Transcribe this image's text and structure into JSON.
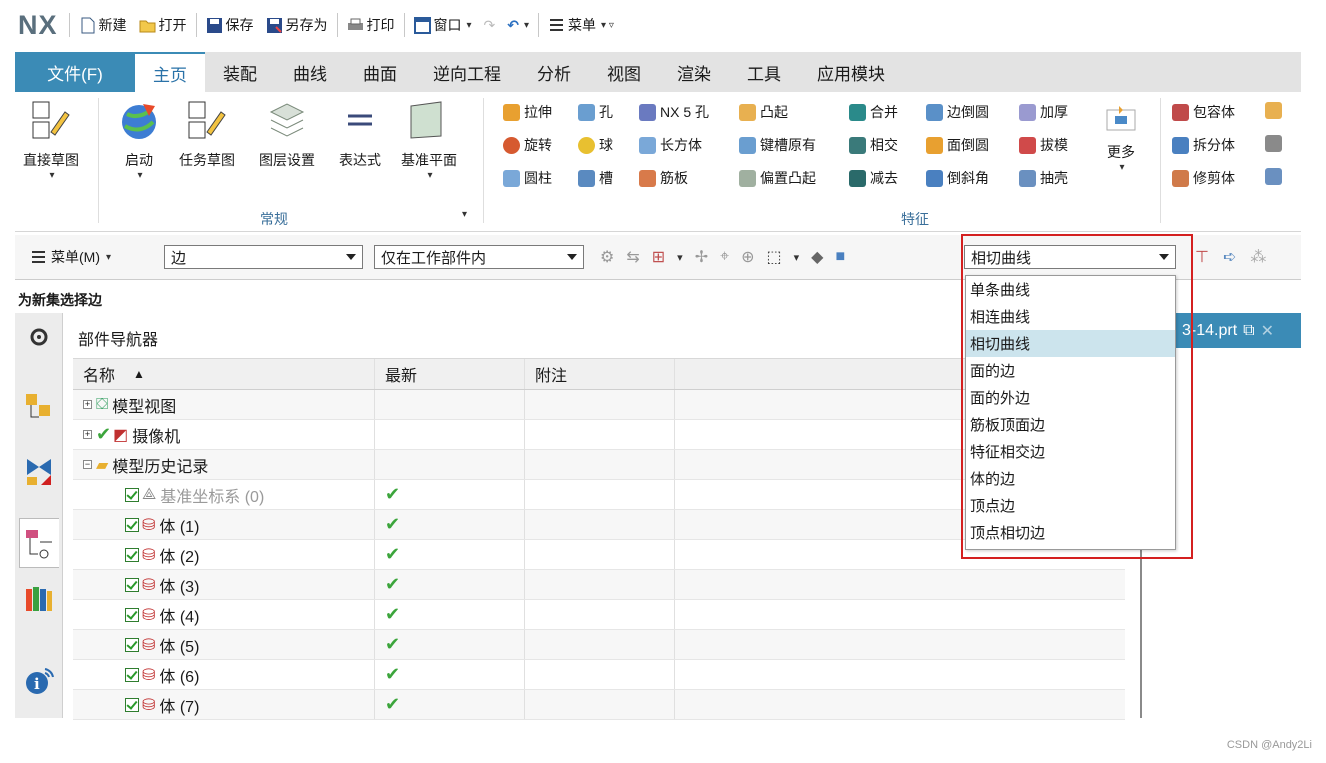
{
  "app": {
    "logo": "NX"
  },
  "qat": [
    {
      "label": "新建",
      "icon": "new-file-icon"
    },
    {
      "label": "打开",
      "icon": "open-folder-icon"
    },
    {
      "label": "保存",
      "icon": "save-icon"
    },
    {
      "label": "另存为",
      "icon": "save-as-icon"
    },
    {
      "label": "打印",
      "icon": "print-icon"
    },
    {
      "label": "窗口",
      "icon": "window-icon"
    },
    {
      "label": "菜单",
      "icon": "menu-icon"
    }
  ],
  "tabs": [
    "文件(F)",
    "主页",
    "装配",
    "曲线",
    "曲面",
    "逆向工程",
    "分析",
    "视图",
    "渲染",
    "工具",
    "应用模块"
  ],
  "ribbon": {
    "big_buttons": [
      "直接草图",
      "启动",
      "任务草图",
      "图层设置",
      "表达式",
      "基准平面",
      "更多"
    ],
    "group_general": "常规",
    "group_feature": "特征",
    "features_col1": [
      "拉伸",
      "旋转",
      "圆柱"
    ],
    "features_col2": [
      "孔",
      "球",
      "槽"
    ],
    "features_col3": [
      "NX 5 孔",
      "长方体",
      "筋板"
    ],
    "features_col4": [
      "凸起",
      "键槽原有",
      "偏置凸起"
    ],
    "features_col5": [
      "合并",
      "相交",
      "减去"
    ],
    "features_col6": [
      "边倒圆",
      "面倒圆",
      "倒斜角"
    ],
    "features_col7": [
      "加厚",
      "拔模",
      "抽壳"
    ],
    "features_col8": [
      "包容体",
      "拆分体",
      "修剪体"
    ]
  },
  "selbar": {
    "menu": "菜单(M)",
    "type_filter": "边",
    "scope": "仅在工作部件内",
    "curve_rule": "相切曲线"
  },
  "hint": "为新集选择边",
  "navigator": {
    "title": "部件导航器",
    "columns": [
      "名称",
      "最新",
      "附注"
    ],
    "rows": [
      {
        "name": "模型视图",
        "latest": "",
        "kind": "views"
      },
      {
        "name": "摄像机",
        "latest": "",
        "kind": "camera"
      },
      {
        "name": "模型历史记录",
        "latest": "",
        "kind": "folder"
      },
      {
        "name": "基准坐标系 (0)",
        "latest": "✔",
        "kind": "datum"
      },
      {
        "name": "体 (1)",
        "latest": "✔",
        "kind": "body"
      },
      {
        "name": "体 (2)",
        "latest": "✔",
        "kind": "body"
      },
      {
        "name": "体 (3)",
        "latest": "✔",
        "kind": "body"
      },
      {
        "name": "体 (4)",
        "latest": "✔",
        "kind": "body"
      },
      {
        "name": "体 (5)",
        "latest": "✔",
        "kind": "body"
      },
      {
        "name": "体 (6)",
        "latest": "✔",
        "kind": "body"
      },
      {
        "name": "体 (7)",
        "latest": "✔",
        "kind": "body"
      }
    ]
  },
  "curve_rule_options": [
    "单条曲线",
    "相连曲线",
    "相切曲线",
    "面的边",
    "面的外边",
    "筋板顶面边",
    "特征相交边",
    "体的边",
    "顶点边",
    "顶点相切边"
  ],
  "curve_rule_selected": "相切曲线",
  "file_tab": "3-14.prt",
  "watermark": "CSDN @Andy2Li",
  "colors": {
    "accent": "#3b8bb6",
    "highlight": "#cce4ed",
    "annotation": "#d42020"
  }
}
